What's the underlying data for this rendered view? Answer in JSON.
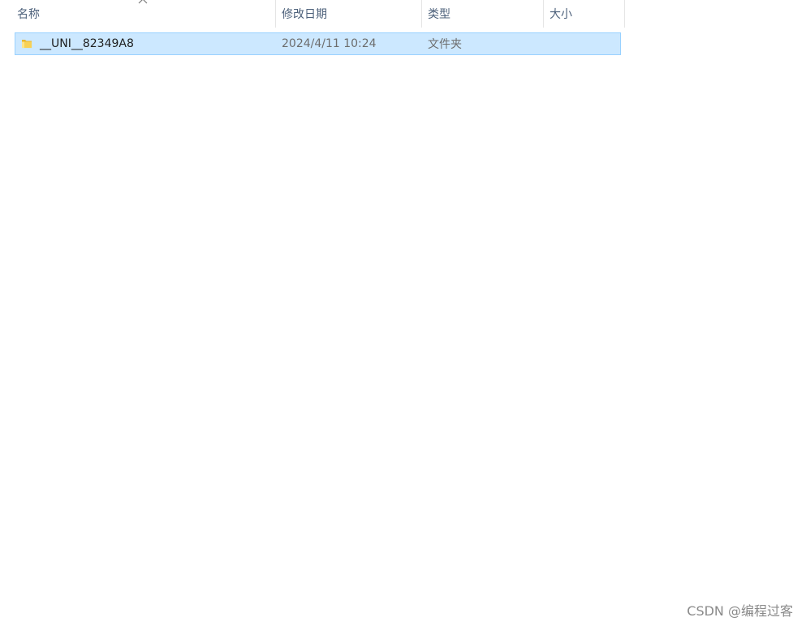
{
  "columns": {
    "name": "名称",
    "date": "修改日期",
    "type": "类型",
    "size": "大小"
  },
  "sort": {
    "column": "name",
    "icon": "chevron-up-icon"
  },
  "files": [
    {
      "name": "__UNI__82349A8",
      "date": "2024/4/11 10:24",
      "type": "文件夹",
      "size": "",
      "icon": "folder-icon",
      "selected": true
    }
  ],
  "colors": {
    "selection_bg": "#cce8ff",
    "selection_border": "#99d1ff",
    "header_text": "#4c607a",
    "folder_yellow": "#f5c842"
  },
  "watermark": "CSDN @编程过客"
}
